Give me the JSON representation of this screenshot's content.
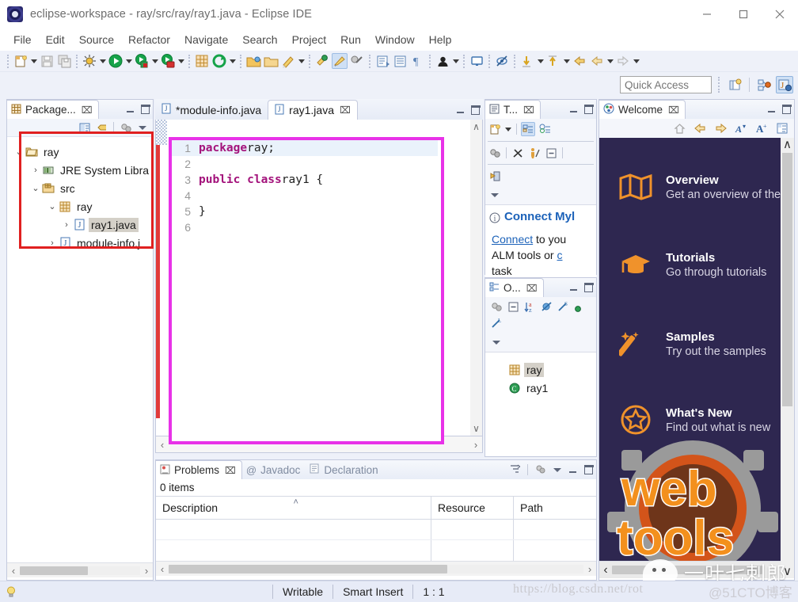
{
  "window": {
    "title": "eclipse-workspace - ray/src/ray/ray1.java - Eclipse IDE",
    "app_icon": "eclipse-icon",
    "minimize": "—",
    "maximize": "□",
    "close": "✕"
  },
  "menubar": {
    "items": [
      {
        "label": "File"
      },
      {
        "label": "Edit"
      },
      {
        "label": "Source"
      },
      {
        "label": "Refactor"
      },
      {
        "label": "Navigate"
      },
      {
        "label": "Search"
      },
      {
        "label": "Project"
      },
      {
        "label": "Run"
      },
      {
        "label": "Window"
      },
      {
        "label": "Help"
      }
    ]
  },
  "toolbar": {
    "icons": [
      "new-wizard-icon",
      "new-dropdown-caret",
      "save-icon",
      "save-all-icon",
      "debug-icon",
      "debug-dropdown-caret",
      "run-icon",
      "run-dropdown-caret",
      "run-external-tools-icon",
      "external-tools-caret",
      "coverage-icon",
      "coverage-caret",
      "new-java-package-icon",
      "refresh-icon",
      "refresh-caret",
      "open-type-icon",
      "open-task-icon",
      "new-task-icon",
      "new-task-caret",
      "search-task-icon",
      "highlight-icon",
      "annotations-icon",
      "toggle-markoccurrences-icon",
      "java-editor-icon",
      "show-whitespace-icon",
      "pilcrow-icon",
      "user-icon",
      "user-caret",
      "console-icon",
      "hide-icon",
      "next-annotation-icon",
      "next-annotation-caret",
      "previous-annotation-icon",
      "previous-annotation-caret",
      "back-icon",
      "forward-icon",
      "forward-caret",
      "next-edit-icon",
      "next-edit-caret"
    ]
  },
  "quick_access": {
    "placeholder": "Quick Access",
    "value": "",
    "buttons": [
      "open-perspective-icon",
      "java-browsing-perspective-icon",
      "java-perspective-icon"
    ]
  },
  "package_explorer": {
    "tab_label": "Package...",
    "tab_icon": "package-explorer-icon",
    "close_label": "⌧",
    "toolbar_icons": [
      "link-with-editor-icon",
      "collapse-all-icon",
      "focus-icon",
      "view-menu-icon"
    ],
    "tree": [
      {
        "indent": 0,
        "twisty": "⌄",
        "icon": "project-folder-icon",
        "label": "ray",
        "selected": false
      },
      {
        "indent": 1,
        "twisty": "›",
        "icon": "jre-library-icon",
        "label": "JRE System Libra",
        "selected": false
      },
      {
        "indent": 1,
        "twisty": "⌄",
        "icon": "source-folder-icon",
        "label": "src",
        "selected": false
      },
      {
        "indent": 2,
        "twisty": "⌄",
        "icon": "package-icon",
        "label": "ray",
        "selected": false
      },
      {
        "indent": 3,
        "twisty": "›",
        "icon": "java-file-icon",
        "label": "ray1.java",
        "selected": true
      },
      {
        "indent": 2,
        "twisty": "›",
        "icon": "java-file-icon",
        "label": "module-info.j",
        "selected": false
      }
    ],
    "hscroll": {
      "left_arrow": "‹",
      "right_arrow": "›"
    }
  },
  "editor": {
    "tabs": [
      {
        "label": "*module-info.java",
        "icon": "java-file-icon",
        "active": false,
        "closable": false
      },
      {
        "label": "ray1.java",
        "icon": "java-file-icon",
        "active": true,
        "closable": true,
        "close_label": "⌧"
      }
    ],
    "minimize_label": "minimize",
    "maximize_label": "maximize",
    "highlight_color": "#e832e8",
    "lines": [
      {
        "no": "1",
        "tokens": [
          {
            "t": "package",
            "k": true
          },
          {
            "t": " ray;",
            "k": false
          }
        ],
        "current": true
      },
      {
        "no": "2",
        "tokens": [],
        "current": false
      },
      {
        "no": "3",
        "tokens": [
          {
            "t": "public class",
            "k": true
          },
          {
            "t": " ray1 {",
            "k": false
          }
        ],
        "current": false
      },
      {
        "no": "4",
        "tokens": [],
        "current": false
      },
      {
        "no": "5",
        "tokens": [
          {
            "t": "}",
            "k": false
          }
        ],
        "current": false
      },
      {
        "no": "6",
        "tokens": [],
        "current": false
      }
    ],
    "hscroll": {
      "left_arrow": "‹",
      "right_arrow": "›"
    },
    "vscroll": {
      "up_arrow": "∧",
      "down_arrow": "∨"
    }
  },
  "task_list": {
    "tab_label": "T...",
    "tab_icon": "task-list-icon",
    "close_label": "⌧",
    "toolbar_icons": [
      "new-task-icon",
      "new-task-caret",
      "categorized-mode-icon",
      "scheduled-mode-icon",
      "synchronize-icon",
      "filter-completed-icon",
      "focus-on-workweek-icon",
      "collapse-all-icon",
      "restore-tasks-icon",
      "view-menu-icon"
    ],
    "notice": {
      "icon": "info-icon",
      "title": "Connect Myl",
      "body_line1_link": "Connect",
      "body_line1_rest": " to you",
      "body_line2": "ALM tools or ",
      "body_line2_link": "c",
      "body_line3": "task"
    }
  },
  "outline": {
    "tab_label": "O...",
    "tab_icon": "outline-icon",
    "close_label": "⌧",
    "toolbar_icons": [
      "focus-icon",
      "collapse-all-icon",
      "sort-icon",
      "hide-fields-icon",
      "hide-static-icon",
      "hide-nonpublic-icon",
      "hide-local-types-icon",
      "view-menu-icon"
    ],
    "tree": [
      {
        "icon": "package-icon",
        "label": "ray",
        "selected": true
      },
      {
        "icon": "class-icon",
        "label": "ray1",
        "selected": false
      }
    ]
  },
  "problems": {
    "tabs": [
      {
        "label": "Problems",
        "icon": "problems-icon",
        "active": true,
        "close_label": "⌧"
      },
      {
        "label": "Javadoc",
        "icon": "javadoc-icon",
        "active": false
      },
      {
        "label": "Declaration",
        "icon": "declaration-icon",
        "active": false
      }
    ],
    "toolbar_icons": [
      "filters-icon",
      "group-by-icon",
      "view-menu-icon"
    ],
    "items_count": "0 items",
    "columns": [
      {
        "label": "Description",
        "sort": "˄"
      },
      {
        "label": "Resource",
        "sort": ""
      },
      {
        "label": "Path",
        "sort": ""
      }
    ],
    "rows": [],
    "hscroll": {
      "left_arrow": "‹",
      "right_arrow": "›"
    }
  },
  "welcome": {
    "tab_label": "Welcome",
    "tab_icon": "welcome-icon",
    "close_label": "⌧",
    "toolbar_icons": [
      "home-icon",
      "back-arrow-icon",
      "forward-arrow-icon",
      "decrease-font-icon",
      "increase-font-icon",
      "customize-page-icon"
    ],
    "background_color": "#2e2750",
    "accent_color": "#f0922b",
    "items": [
      {
        "icon": "overview-map-icon",
        "title": "Overview",
        "subtitle": "Get an overview of the f"
      },
      {
        "icon": "tutorials-cap-icon",
        "title": "Tutorials",
        "subtitle": "Go through tutorials"
      },
      {
        "icon": "samples-wand-icon",
        "title": "Samples",
        "subtitle": "Try out the samples"
      },
      {
        "icon": "whats-new-star-icon",
        "title": "What's New",
        "subtitle": "Find out what is new"
      }
    ],
    "footer_logo": "web tools",
    "vscroll": {
      "up_arrow": "∧",
      "down_arrow": "∨"
    },
    "hscroll": {
      "left_arrow": "‹"
    }
  },
  "status_bar": {
    "hint_icon": "lightbulb-icon",
    "writable": "Writable",
    "insert_mode": "Smart Insert",
    "position": "1 : 1"
  },
  "watermarks": {
    "url": "https://blog.csdn.net/rot",
    "cto": "@51CTO博客",
    "wechat_name": "一叶七刺郎"
  },
  "annotations": {
    "tree_box_color": "#e02020",
    "code_box_color": "#e832e8"
  }
}
